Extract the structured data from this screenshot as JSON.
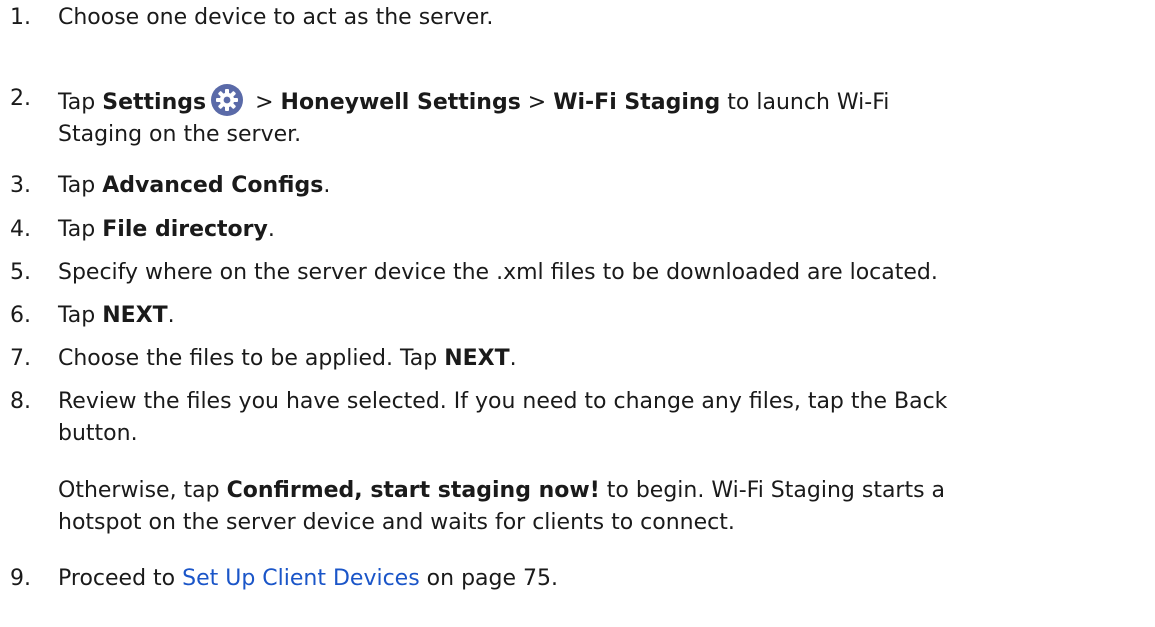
{
  "steps": [
    {
      "num": "1.",
      "text": "Choose one device to act as the server."
    },
    {
      "num": "2.",
      "pre": "Tap ",
      "bold1": "Settings",
      "sep1": " > ",
      "bold2": "Honeywell Settings",
      "sep2": " > ",
      "bold3": "Wi-Fi Staging",
      "post": " to launch Wi-Fi",
      "line2": "Staging on the server.",
      "icon": "settings-gear-icon",
      "icon_color": "#5a6aa8"
    },
    {
      "num": "3.",
      "pre": "Tap ",
      "bold": "Advanced Configs",
      "post": "."
    },
    {
      "num": "4.",
      "pre": "Tap ",
      "bold": "File directory",
      "post": "."
    },
    {
      "num": "5.",
      "text": "Specify where on the server device the .xml files to be downloaded are located."
    },
    {
      "num": "6.",
      "pre": "Tap ",
      "bold": "NEXT",
      "post": "."
    },
    {
      "num": "7.",
      "pre": "Choose the files to be applied. Tap ",
      "bold": "NEXT",
      "post": "."
    },
    {
      "num": "8.",
      "line1": "Review the files you have selected. If you need to change any files, tap the Back",
      "line2": "button."
    },
    {
      "num": "9.",
      "pre": "Proceed to ",
      "link": "Set Up Client Devices",
      "post": " on page 75."
    }
  ],
  "step8_para": {
    "pre": "Otherwise, tap ",
    "bold": "Confirmed, start staging now!",
    "post": " to begin. Wi-Fi Staging starts a",
    "line2": "hotspot on the server device and waits for clients to connect."
  },
  "link_color": "#1a55c8"
}
